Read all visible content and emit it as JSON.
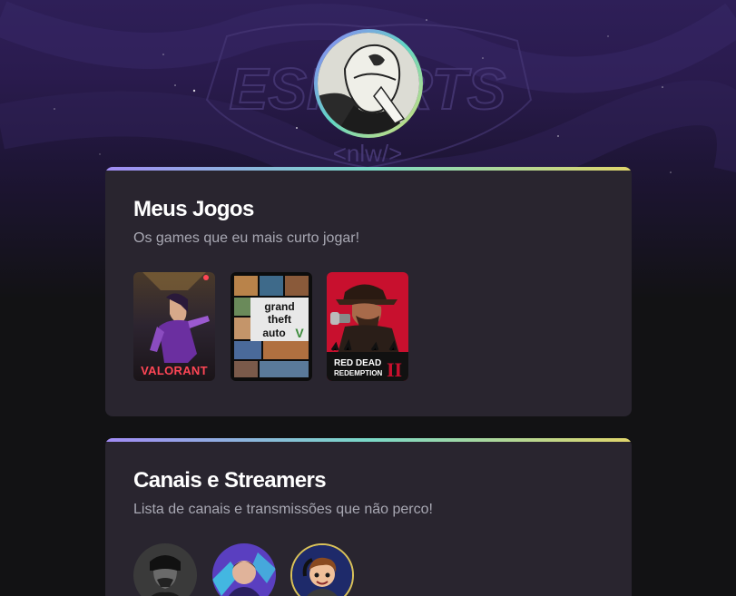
{
  "profile": {
    "avatar_icon": "masked-character-avatar-icon",
    "background_logo_text": "ESPORTS",
    "background_tag_text": "<nlw/>"
  },
  "games_section": {
    "title": "Meus Jogos",
    "subtitle": "Os games que eu mais curto jogar!",
    "games": [
      {
        "name": "VALORANT",
        "icon": "valorant-cover-icon"
      },
      {
        "name": "Grand Theft Auto V",
        "icon": "gta-v-cover-icon"
      },
      {
        "name": "Red Dead Redemption II",
        "icon": "red-dead-redemption-cover-icon"
      }
    ]
  },
  "channels_section": {
    "title": "Canais e Streamers",
    "subtitle": "Lista de canais e transmissões que não perco!",
    "channels": [
      {
        "icon": "streamer-1-avatar-icon"
      },
      {
        "icon": "streamer-2-avatar-icon"
      },
      {
        "icon": "streamer-3-avatar-icon"
      }
    ]
  },
  "colors": {
    "page_bg": "#121214",
    "card_bg": "#29252f",
    "gradient_start": "#a18bf5",
    "gradient_mid": "#7ad9c8",
    "gradient_end": "#e0d56b",
    "title": "#ffffff",
    "subtitle": "#a8a8b3"
  }
}
